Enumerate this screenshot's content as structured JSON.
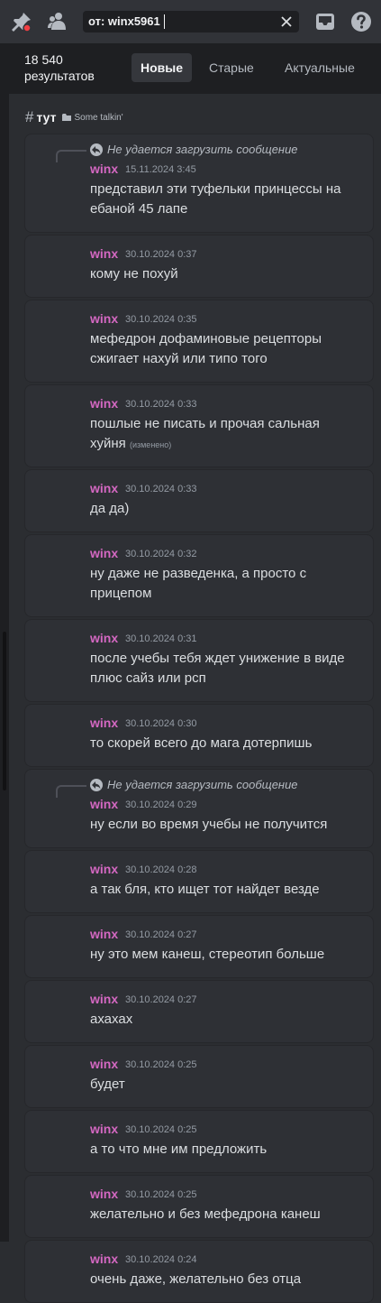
{
  "topbar": {
    "icons": [
      "pin-icon",
      "members-icon",
      "inbox-icon",
      "help-icon"
    ],
    "search_token": "от: winx5961",
    "clear_icon": "close-icon"
  },
  "results": {
    "count": "18 540",
    "count_label": "результатов",
    "sort_tabs": [
      "Новые",
      "Старые",
      "Актуальные"
    ],
    "active_sort": "Новые"
  },
  "channel": {
    "name": "тут",
    "category": "Some talkin'"
  },
  "colors": {
    "author": "#d468c2",
    "background": "#2b2d31",
    "card": "#2e3035",
    "notification_dot": "#f23f43"
  },
  "reply_notice": "Не удается загрузить сообщение",
  "edited_label": "(изменено)",
  "messages": [
    {
      "author": "winx",
      "ts": "15.11.2024 3:45",
      "reply": true,
      "lines": [
        "представил эти туфельки принцессы на",
        "ебаной 45 лапе"
      ]
    },
    {
      "author": "winx",
      "ts": "30.10.2024 0:37",
      "lines": [
        "кому не похуй"
      ]
    },
    {
      "author": "winx",
      "ts": "30.10.2024 0:35",
      "lines": [
        "мефедрон дофаминовые рецепторы",
        "сжигает нахуй или типо того"
      ]
    },
    {
      "author": "winx",
      "ts": "30.10.2024 0:33",
      "edited": true,
      "lines": [
        "пошлые не писать и прочая сальная",
        "хуйня"
      ]
    },
    {
      "author": "winx",
      "ts": "30.10.2024 0:33",
      "lines": [
        "да да)"
      ]
    },
    {
      "author": "winx",
      "ts": "30.10.2024 0:32",
      "lines": [
        "ну даже не разведенка, а просто с",
        "прицепом"
      ]
    },
    {
      "author": "winx",
      "ts": "30.10.2024 0:31",
      "lines": [
        "после учебы тебя ждет унижение в виде",
        "плюс сайз или рсп"
      ]
    },
    {
      "author": "winx",
      "ts": "30.10.2024 0:30",
      "lines": [
        "то скорей всего до мага дотерпишь"
      ]
    },
    {
      "author": "winx",
      "ts": "30.10.2024 0:29",
      "reply": true,
      "lines": [
        "ну если во время учебы не получится"
      ]
    },
    {
      "author": "winx",
      "ts": "30.10.2024 0:28",
      "lines": [
        "а так бля, кто ищет тот найдет везде"
      ]
    },
    {
      "author": "winx",
      "ts": "30.10.2024 0:27",
      "lines": [
        "ну это мем канеш, стереотип больше"
      ]
    },
    {
      "author": "winx",
      "ts": "30.10.2024 0:27",
      "lines": [
        "ахахах"
      ]
    },
    {
      "author": "winx",
      "ts": "30.10.2024 0:25",
      "lines": [
        "будет"
      ]
    },
    {
      "author": "winx",
      "ts": "30.10.2024 0:25",
      "lines": [
        "а то что мне им предложить"
      ]
    },
    {
      "author": "winx",
      "ts": "30.10.2024 0:25",
      "lines": [
        "желательно и без мефедрона канеш"
      ]
    },
    {
      "author": "winx",
      "ts": "30.10.2024 0:24",
      "lines": [
        "очень даже, желательно без отца"
      ]
    }
  ]
}
